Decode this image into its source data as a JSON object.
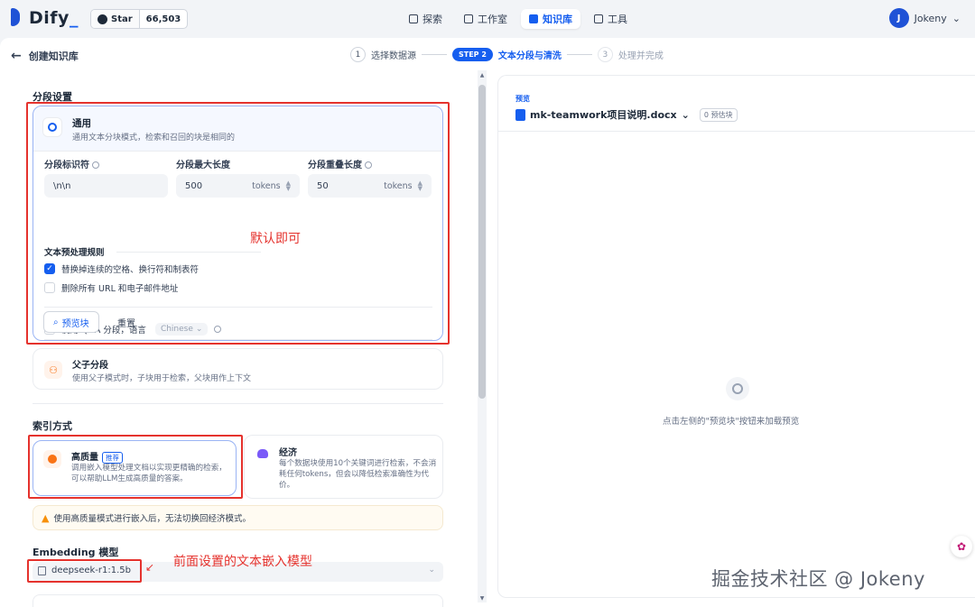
{
  "app": {
    "logo_text": "Dify",
    "logo_suffix": "_"
  },
  "github": {
    "star_label": "Star",
    "star_count": "66,503"
  },
  "nav": {
    "items": [
      {
        "label": "探索",
        "icon": "explore-icon"
      },
      {
        "label": "工作室",
        "icon": "studio-icon"
      },
      {
        "label": "知识库",
        "icon": "knowledge-icon",
        "active": true
      },
      {
        "label": "工具",
        "icon": "tools-icon"
      }
    ]
  },
  "user": {
    "initial": "J",
    "name": "Jokeny"
  },
  "page": {
    "back_title": "创建知识库"
  },
  "steps": {
    "step1_num": "1",
    "step1_label": "选择数据源",
    "step2_pill": "STEP 2",
    "step2_label": "文本分段与清洗",
    "step3_num": "3",
    "step3_label": "处理并完成"
  },
  "segment": {
    "section_title": "分段设置",
    "general_title": "通用",
    "general_desc": "通用文本分块模式，检索和召回的块是相同的",
    "identifier_label": "分段标识符",
    "identifier_value": "\\n\\n",
    "max_len_label": "分段最大长度",
    "max_len_value": "500",
    "overlap_label": "分段重叠长度",
    "overlap_value": "50",
    "unit": "tokens",
    "rules_title": "文本预处理规则",
    "rule1": "替换掉连续的空格、换行符和制表符",
    "rule1_checked": true,
    "rule2": "删除所有 URL 和电子邮件地址",
    "rule2_checked": false,
    "qa_label": "使用 Q&A 分段，语言",
    "qa_lang": "Chinese",
    "preview_btn": "预览块",
    "reset_btn": "重置",
    "parent_title": "父子分段",
    "parent_desc": "使用父子模式时，子块用于检索，父块用作上下文"
  },
  "annotations": {
    "default_note": "默认即可",
    "embed_note": "前面设置的文本嵌入模型"
  },
  "index": {
    "section_title": "索引方式",
    "hq_title": "高质量",
    "hq_badge": "推荐",
    "hq_desc": "调用嵌入模型处理文档以实现更精确的检索，可以帮助LLM生成高质量的答案。",
    "eco_title": "经济",
    "eco_desc": "每个数据块使用10个关键词进行检索，不会消耗任何tokens，但会以降低检索准确性为代价。",
    "warning": "使用高质量模式进行嵌入后，无法切换回经济模式。"
  },
  "embedding": {
    "section_title": "Embedding 模型",
    "model": "deepseek-r1:1.5b"
  },
  "preview": {
    "label": "预览",
    "doc_name": "mk-teamwork项目说明.docx",
    "count": "0 预估块",
    "empty_text": "点击左侧的\"预览块\"按钮来加载预览"
  },
  "watermark": "掘金技术社区 @ Jokeny",
  "colors": {
    "accent": "#155eef",
    "annotation": "#e5322d",
    "brand": "#1f52d6"
  }
}
